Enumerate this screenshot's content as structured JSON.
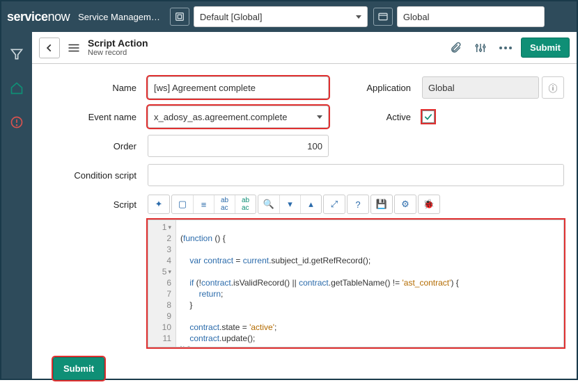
{
  "banner": {
    "logo_main": "service",
    "logo_suffix": "now",
    "title": "Service Managem…",
    "picker1": "Default [Global]",
    "picker2": "Global"
  },
  "header": {
    "title": "Script Action",
    "subtitle": "New record",
    "submit": "Submit"
  },
  "form": {
    "name_label": "Name",
    "name_value": "[ws] Agreement complete",
    "event_label": "Event name",
    "event_value": "x_adosy_as.agreement.complete",
    "order_label": "Order",
    "order_value": "100",
    "application_label": "Application",
    "application_value": "Global",
    "active_label": "Active",
    "active_checked": true,
    "condition_label": "Condition script",
    "condition_value": "",
    "script_label": "Script"
  },
  "editor": {
    "lines": [
      "(function () {",
      "",
      "    var contract = current.subject_id.getRefRecord();",
      "",
      "    if (!contract.isValidRecord() || contract.getTableName() != 'ast_contract') {",
      "        return;",
      "    }",
      "",
      "    contract.state = 'active';",
      "    contract.update();",
      "})();"
    ]
  },
  "bottom": {
    "submit": "Submit"
  }
}
